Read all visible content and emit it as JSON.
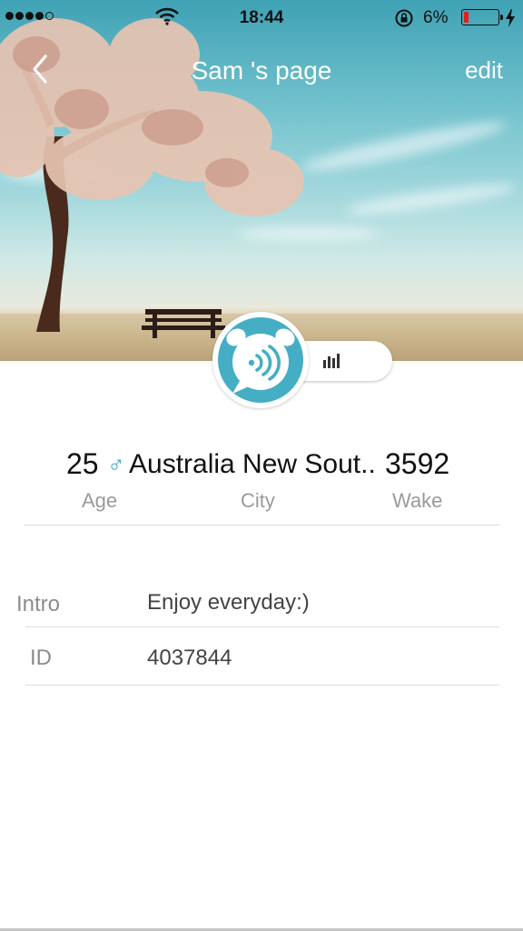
{
  "status_bar": {
    "signal_dots": 5,
    "signal_filled": 4,
    "time": "18:44",
    "battery_percent": "6%",
    "battery_level": 0.06,
    "battery_color": "#e02020"
  },
  "nav": {
    "back_icon": "chevron-left-icon",
    "title": "Sam 's page",
    "edit_label": "edit"
  },
  "profile": {
    "avatar_icon": "alarm-clock-sound-icon",
    "voice_icon": "audio-bars-icon",
    "accent_color": "#45aec5"
  },
  "stats": {
    "age_value": "25",
    "gender_symbol": "♂",
    "city_value": "Australia New Sout..",
    "wake_value": "3592",
    "age_label": "Age",
    "city_label": "City",
    "wake_label": "Wake"
  },
  "info": {
    "intro_label": "Intro",
    "intro_value": "Enjoy everyday:)",
    "id_label": "ID",
    "id_value": "4037844"
  }
}
